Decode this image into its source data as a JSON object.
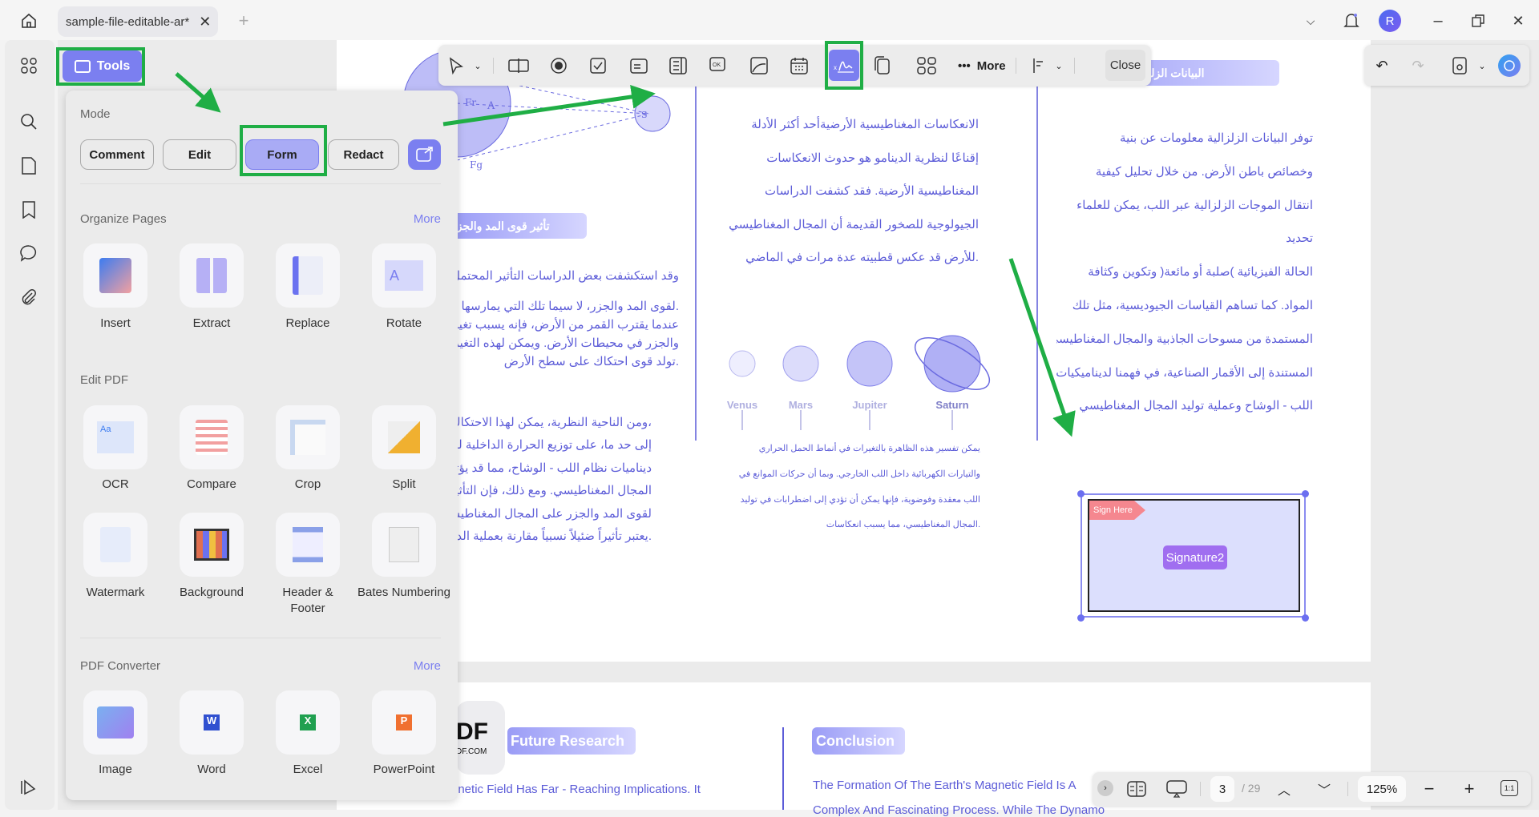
{
  "window": {
    "tab_title": "sample-file-editable-ar*",
    "avatar_letter": "R"
  },
  "tools_button": "Tools",
  "panel": {
    "mode_label": "Mode",
    "modes": [
      "Comment",
      "Edit",
      "Form",
      "Redact"
    ],
    "active_mode": "Form",
    "organize": {
      "title": "Organize Pages",
      "more": "More",
      "items": [
        "Insert",
        "Extract",
        "Replace",
        "Rotate"
      ]
    },
    "edit": {
      "title": "Edit PDF",
      "items": [
        "OCR",
        "Compare",
        "Crop",
        "Split",
        "Watermark",
        "Background",
        "Header & Footer",
        "Bates Numbering"
      ]
    },
    "converter": {
      "title": "PDF Converter",
      "more": "More",
      "items": [
        "Image",
        "Word",
        "Excel",
        "PowerPoint"
      ]
    }
  },
  "form_toolbar": {
    "more": "More",
    "close": "Close"
  },
  "bottom_bar": {
    "page": "3",
    "total": "/ 29",
    "zoom": "125%",
    "fit": "1:1"
  },
  "document": {
    "left_heading": "تأثير قوى المد والجزر",
    "left_p1": "وقد استكشفت بعض الدراسات التأثير المحتمل",
    "left_p2": [
      ".لقوى المد والجزر، لا سيما تلك التي يمارسها",
      "عندما يقترب القمر من الأرض، فإنه يسبب تغيرات",
      "والجزر في محيطات الأرض. ويمكن لهذه التغيرات",
      ".تولد قوى احتكاك على سطح الأرض"
    ],
    "left_p3": [
      "،ومن الناحية النظرية، يمكن لهذا الاحتكاك",
      "إلى حد ما، على توزيع الحرارة الداخلية للأرض",
      "ديناميات نظام اللب - الوشاح، مما قد يؤثر على",
      "المجال المغناطيسي. ومع ذلك، فإن التأثير",
      "لقوى المد والجزر على المجال المغناطيسي",
      ".يعتبر تأثيراً ضئيلاً نسبياً مقارنة بعملية الدينامو"
    ],
    "mid_p1": [
      "الانعكاسات المغناطيسية الأرضيةأحد أكثر الأدلة",
      "إقناعًا لنظرية الدينامو هو حدوث الانعكاسات",
      "المغناطيسية الأرضية. فقد كشفت الدراسات",
      "الجيولوجية للصخور القديمة أن المجال المغناطيسي",
      ".للأرض قد عكس قطبيته عدة مرات في الماضي"
    ],
    "planets": [
      "Venus",
      "Mars",
      "Jupiter",
      "Saturn"
    ],
    "mid_p2": [
      "يمكن تفسير هذه الظاهرة بالتغيرات في أنماط الحمل الحراري",
      "والتيارات الكهربائية داخل اللب الخارجي. وبما أن حركات الموانع في",
      "اللب معقدة وفوضوية، فإنها يمكن أن تؤدي إلى اضطرابات في توليد",
      ".المجال المغناطيسي، مما يسبب انعكاسات"
    ],
    "right_heading": "البيانات الزلزالية والجيوديسية",
    "right_p": [
      "توفر البيانات الزلزالية معلومات عن بنية",
      "وخصائص باطن الأرض. من خلال تحليل كيفية",
      "انتقال الموجات الزلزالية عبر اللب، يمكن للعلماء",
      "تحديد",
      "الحالة الفيزيائية )صلبة أو مائعة( وتكوين وكثافة",
      "المواد. كما تساهم القياسات الجيوديسية، مثل تلك",
      "المستمدة من مسوحات الجاذبية والمجال المغناطيسي",
      "المستندة إلى الأقمار الصناعية، في فهمنا لديناميكيات",
      "اللب - الوشاح وعملية توليد المجال المغناطيسي"
    ],
    "signature": {
      "tag": "Sign Here",
      "name": "Signature2"
    },
    "logo": {
      "text": "DF",
      "sub": "DF.COM"
    },
    "page2": {
      "future_heading": "Future Research",
      "future_text": "gnetic Field Has Far - Reaching Implications. It",
      "conclusion_heading": "Conclusion",
      "conclusion_text": "The Formation Of The Earth's Magnetic Field Is A",
      "conclusion_text2": "Complex And Fascinating Process. While The Dynamo"
    }
  },
  "colors": {
    "accent": "#7b7ff0",
    "doc_text": "#5c5cd8",
    "annotation": "#1fae45"
  }
}
